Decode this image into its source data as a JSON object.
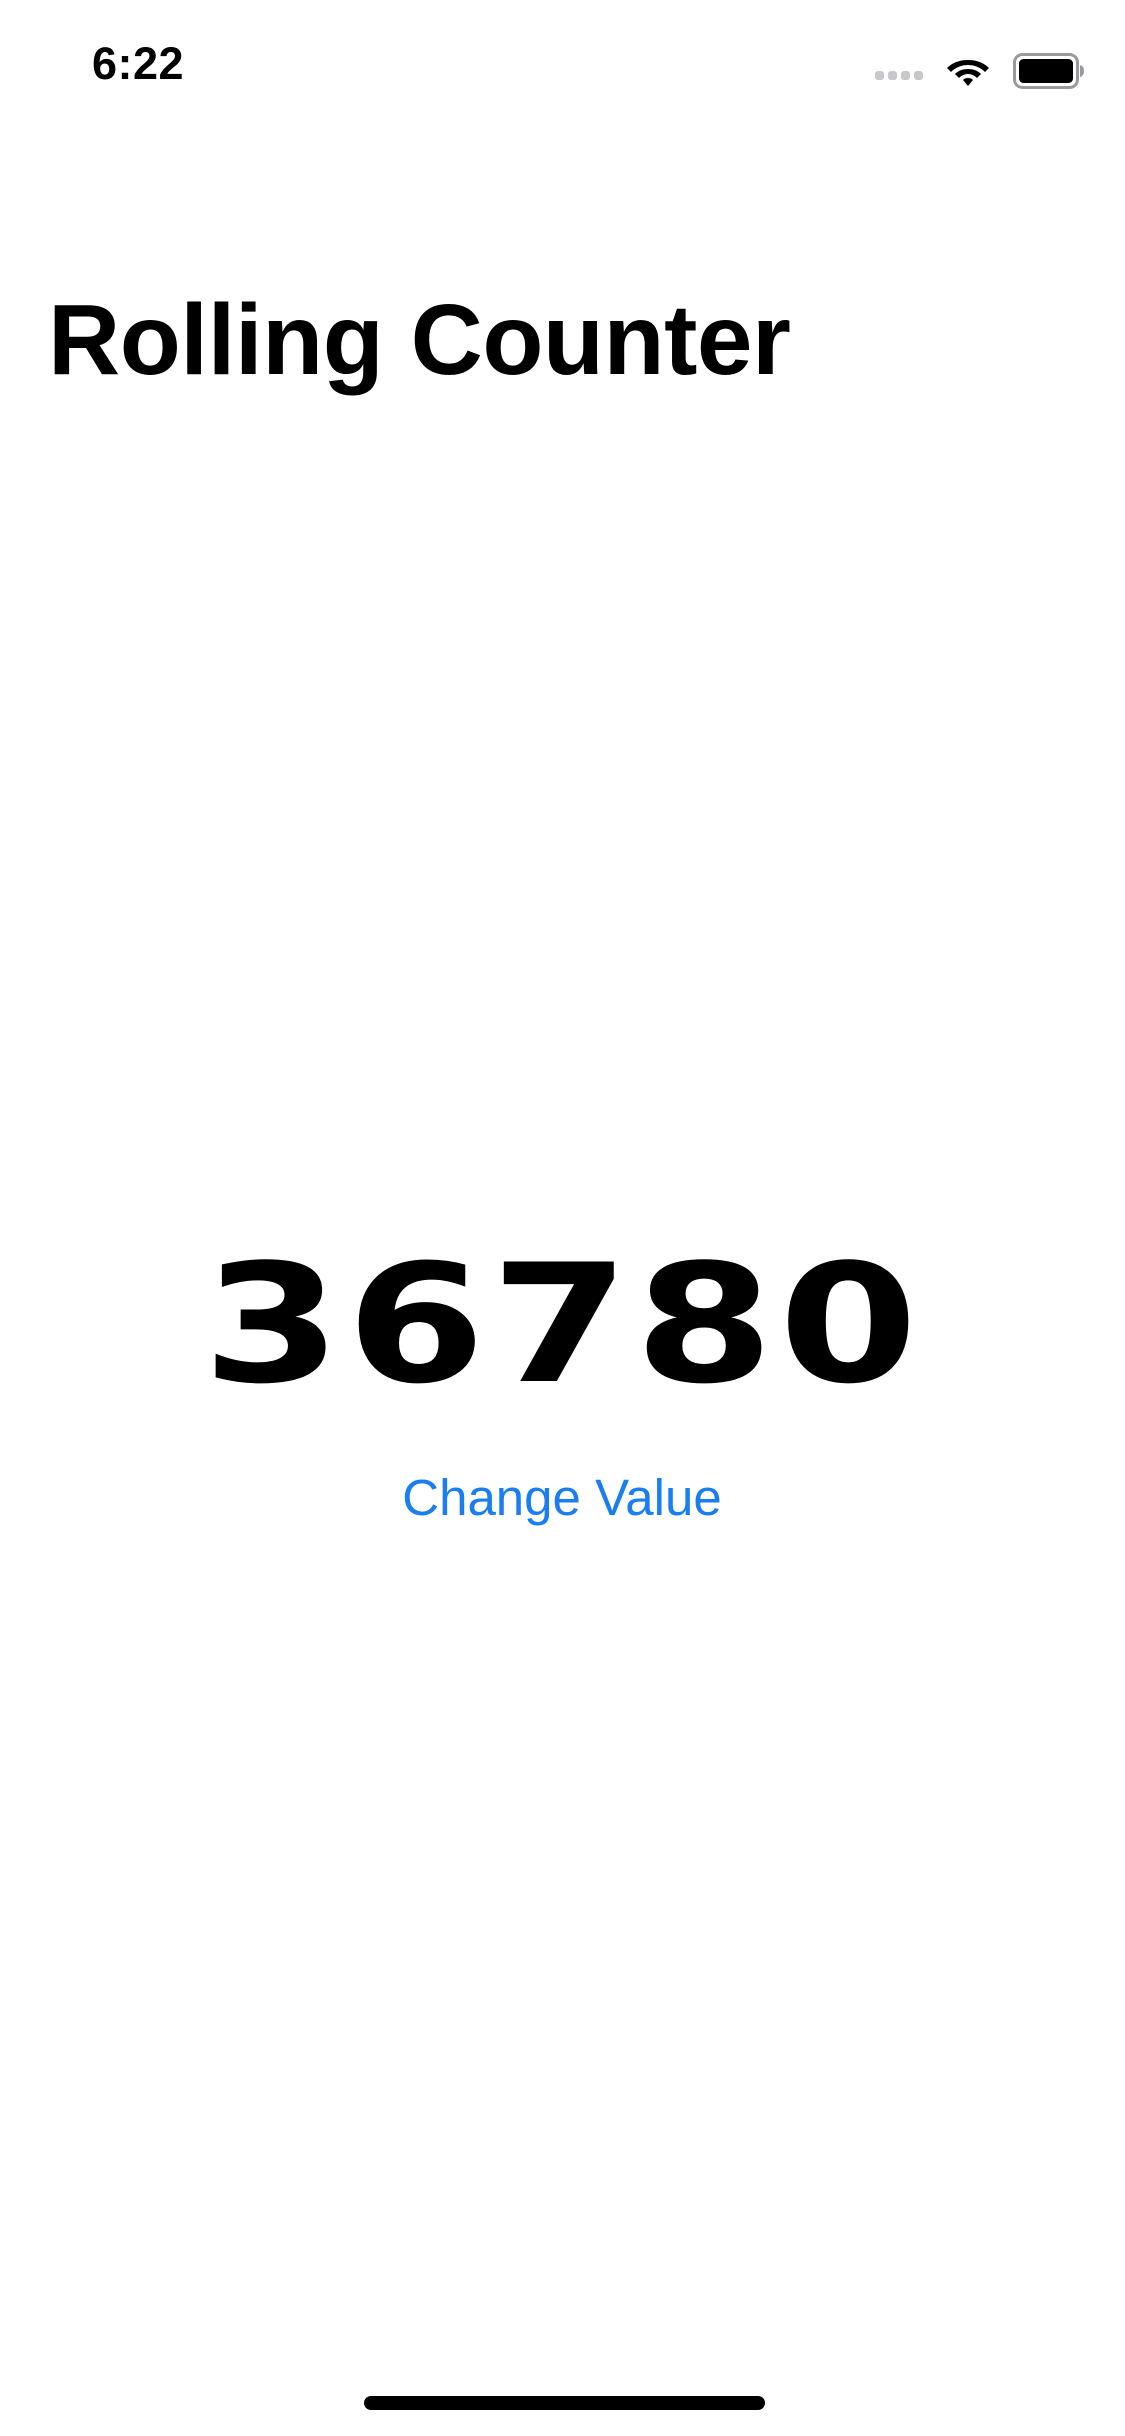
{
  "status_bar": {
    "time": "6:22",
    "icons": [
      "cellular-signal-icon",
      "wifi-icon",
      "battery-icon"
    ]
  },
  "page": {
    "title": "Rolling Counter"
  },
  "counter": {
    "value": "36780"
  },
  "actions": {
    "change_value_label": "Change Value"
  },
  "colors": {
    "accent": "#1a7ef0",
    "text": "#000000",
    "background": "#ffffff"
  }
}
